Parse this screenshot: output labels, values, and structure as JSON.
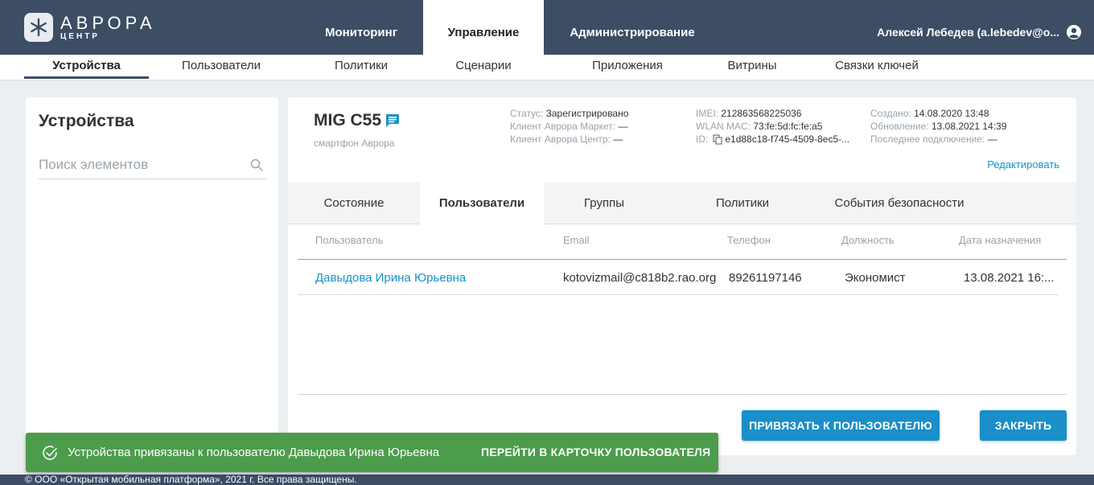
{
  "app": {
    "logo_name": "АВРОРА",
    "logo_sub": "ЦЕНТР",
    "brand_color": "#3c4d64",
    "accent_color": "#1a8fc9",
    "success_color": "#4c9c4c"
  },
  "topnav": {
    "items": [
      "Мониторинг",
      "Управление",
      "Администрирование"
    ],
    "active": "Управление"
  },
  "user": {
    "name": "Алексей Лебедев (a.lebedev@o...",
    "icon": "user-circle-icon"
  },
  "subnav": {
    "items": [
      "Устройства",
      "Пользователи",
      "Политики",
      "Сценарии",
      "Приложения",
      "Витрины",
      "Связки ключей"
    ],
    "active": "Устройства"
  },
  "left": {
    "title": "Устройства",
    "search_placeholder": "Поиск элементов"
  },
  "device": {
    "name": "MIG C55",
    "type": "смартфон Аврора",
    "status_key": "Статус:",
    "status_val": "Зарегистрировано",
    "market_key": "Клиент Аврора Маркет:",
    "market_val": "—",
    "center_key": "Клиент Аврора Центр:",
    "center_val": "—",
    "imei_key": "IMEI:",
    "imei_val": "212863568225036",
    "mac_key": "WLAN MAC:",
    "mac_val": "73:fe:5d:fc:fe:a5",
    "id_key": "ID:",
    "id_val": "e1d88c18-f745-4509-8ec5-...",
    "created_key": "Создано:",
    "created_val": "14.08.2020 13:48",
    "updated_key": "Обновление:",
    "updated_val": "13.08.2021 14:39",
    "lastconn_key": "Последнее подключение:",
    "lastconn_val": "—",
    "edit_label": "Редактировать"
  },
  "tabs": {
    "items": [
      "Состояние",
      "Пользователи",
      "Группы",
      "Политики",
      "События безопасности"
    ],
    "active": "Пользователи"
  },
  "table": {
    "columns": [
      "Пользователь",
      "Email",
      "Телефон",
      "Должность",
      "Дата назначения"
    ],
    "rows": [
      {
        "user": "Давыдова Ирина Юрьевна",
        "email": "kotovizmail@c818b2.rao.org",
        "phone": "89261197146",
        "position": "Экономист",
        "date": "13.08.2021 16:..."
      }
    ]
  },
  "buttons": {
    "bind_user": "ПРИВЯЗАТЬ К ПОЛЬЗОВАТЕЛЮ",
    "close": "ЗАКРЫТЬ"
  },
  "toast": {
    "message": "Устройства привязаны к пользователю Давыдова Ирина Юрьевна",
    "action": "ПЕРЕЙТИ В КАРТОЧКУ ПОЛЬЗОВАТЕЛЯ"
  },
  "footer": {
    "text": "© ООО «Открытая мобильная платформа», 2021 г. Все права защищены."
  }
}
